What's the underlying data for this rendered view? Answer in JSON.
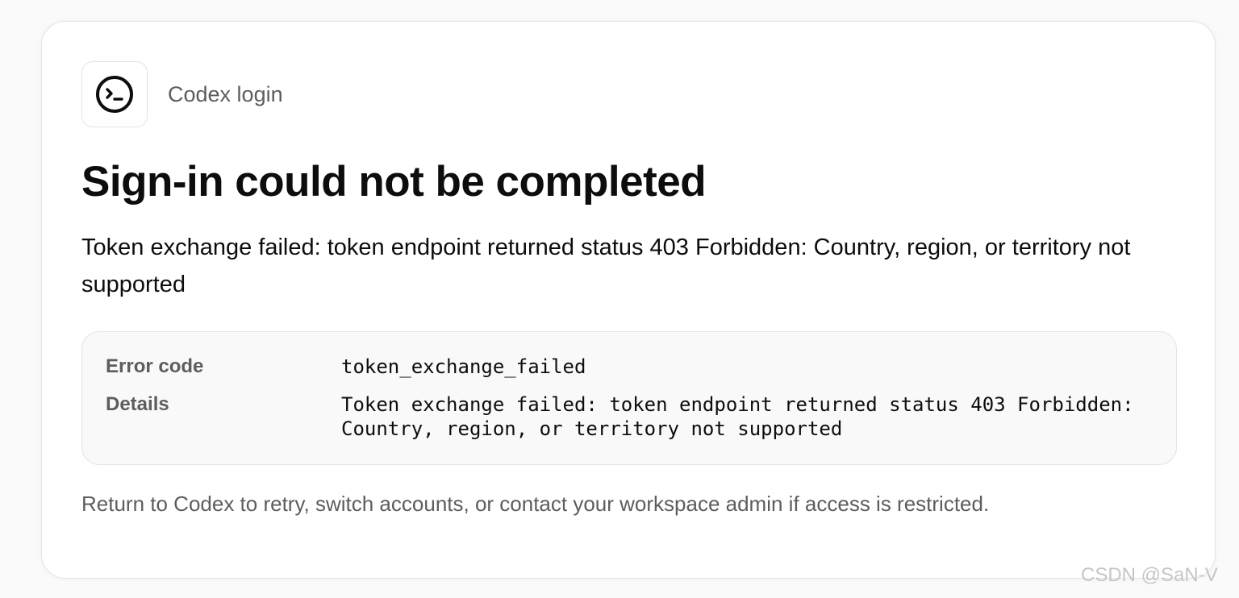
{
  "header": {
    "brand": "Codex login",
    "logo_icon": "terminal-prompt-icon"
  },
  "title": "Sign-in could not be completed",
  "message": "Token exchange failed: token endpoint returned status 403 Forbidden: Country, region, or territory not supported",
  "details": [
    {
      "key": "Error code",
      "value": "token_exchange_failed"
    },
    {
      "key": "Details",
      "value": "Token exchange failed: token endpoint returned status 403 Forbidden: Country, region, or territory not supported"
    }
  ],
  "footer": "Return to Codex to retry, switch accounts, or contact your workspace admin if access is restricted.",
  "watermark": "CSDN @SaN-V",
  "colors": {
    "background": "#fafafa",
    "card": "#ffffff",
    "border": "#e3e3e3",
    "text_primary": "#0d0d0d",
    "text_secondary": "#5d5d5d",
    "details_bg": "#f9f9f9"
  }
}
